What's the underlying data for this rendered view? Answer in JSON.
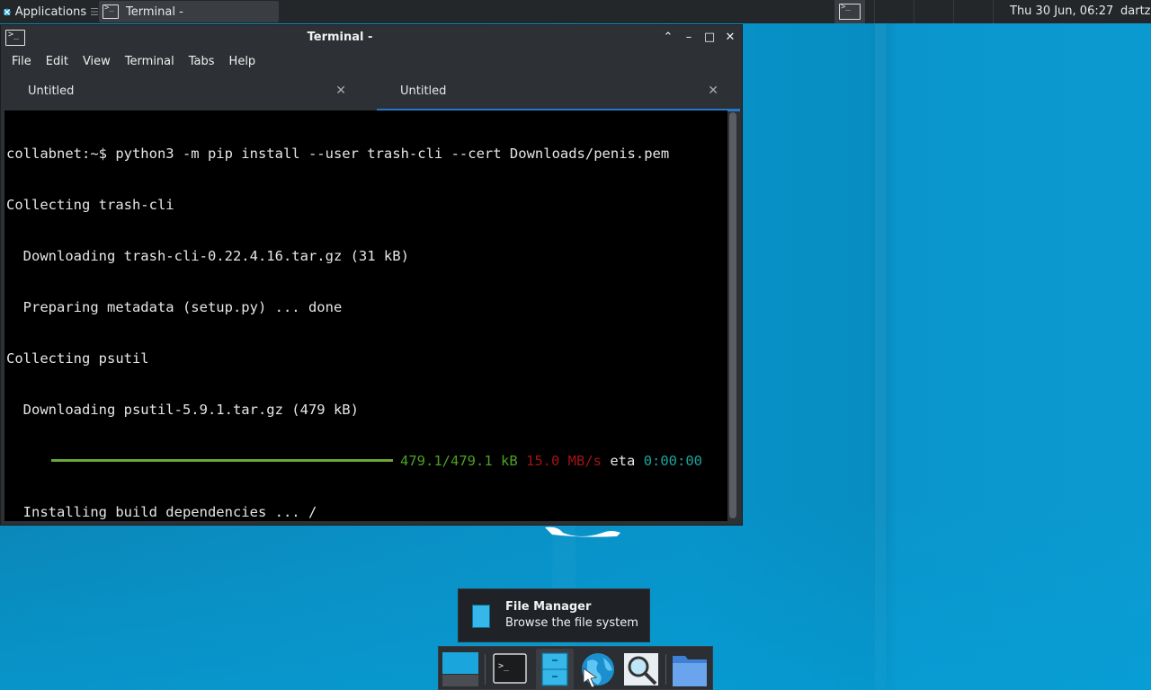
{
  "top_panel": {
    "applications_label": "Applications",
    "task_title": "Terminal -",
    "clock": "Thu 30 Jun, 06:27",
    "user": "dartz"
  },
  "window": {
    "title": "Terminal -",
    "menu": [
      "File",
      "Edit",
      "View",
      "Terminal",
      "Tabs",
      "Help"
    ],
    "tabs": [
      {
        "label": "Untitled",
        "active": false
      },
      {
        "label": "Untitled",
        "active": true
      }
    ],
    "controls": {
      "maximize_up": "⌃",
      "minimize": "–",
      "maximize": "□",
      "close": "✕"
    }
  },
  "terminal": {
    "lines": [
      "collabnet:~$ python3 -m pip install --user trash-cli --cert Downloads/penis.pem",
      "Collecting trash-cli",
      "  Downloading trash-cli-0.22.4.16.tar.gz (31 kB)",
      "  Preparing metadata (setup.py) ... done",
      "Collecting psutil",
      "  Downloading psutil-5.9.1.tar.gz (479 kB)"
    ],
    "progress": {
      "fraction": 1.0,
      "size": "479.1/479.1 kB",
      "speed": "15.0 MB/s",
      "eta_label": "eta",
      "eta": "0:00:00"
    },
    "last_line": "  Installing build dependencies ... /"
  },
  "tooltip": {
    "title": "File Manager",
    "description": "Browse the file system"
  },
  "dock": {
    "items": [
      "show-desktop",
      "terminal",
      "file-manager",
      "web-browser",
      "app-finder",
      "folder"
    ]
  },
  "colors": {
    "desktop": "#0a8ec3",
    "panel": "#24272a",
    "progress_bar": "#6aa63a",
    "progress_size": "#4ea024",
    "progress_speed": "#a01414",
    "progress_eta": "#1aa39c",
    "tab_accent": "#2577c8"
  }
}
